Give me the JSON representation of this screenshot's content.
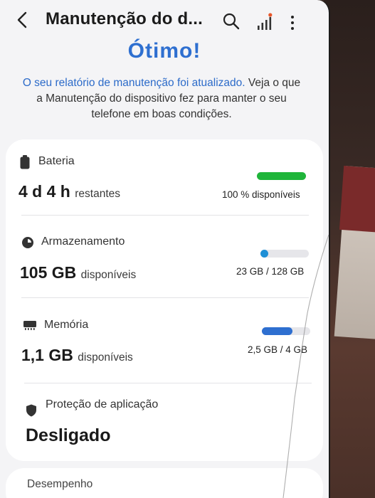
{
  "appbar": {
    "title": "Manutenção do d...",
    "back_icon": "chevron-left-icon",
    "search_icon": "search-icon",
    "stats_icon": "signal-bars-icon",
    "more_icon": "more-vertical-icon"
  },
  "headline": "Ótimo!",
  "report": {
    "link_text": "O seu relatório de manutenção foi atualizado.",
    "rest_text": " Veja o que a Manutenção do dispositivo fez para manter o seu telefone em boas condições."
  },
  "battery": {
    "label": "Bateria",
    "value": "4 d 4 h",
    "unit": "restantes",
    "right": "100 % disponíveis",
    "fill_fraction": 1.0,
    "color": "#1fb53a"
  },
  "storage": {
    "label": "Armazenamento",
    "value": "105 GB",
    "unit": "disponíveis",
    "right": "23 GB / 128 GB",
    "fill_fraction": 0.18,
    "color": "#1e8fd6"
  },
  "memory": {
    "label": "Memória",
    "value": "1,1 GB",
    "unit": "disponíveis",
    "right": "2,5 GB / 4 GB",
    "fill_fraction": 0.625,
    "color": "#2e6fd0"
  },
  "protection": {
    "label": "Proteção de aplicação",
    "value": "Desligado"
  },
  "performance": {
    "label": "Desempenho"
  },
  "colors": {
    "accent": "#2e6fd0",
    "battery": "#1fb53a",
    "storage": "#1e8fd6",
    "memory": "#2e6fd0"
  }
}
